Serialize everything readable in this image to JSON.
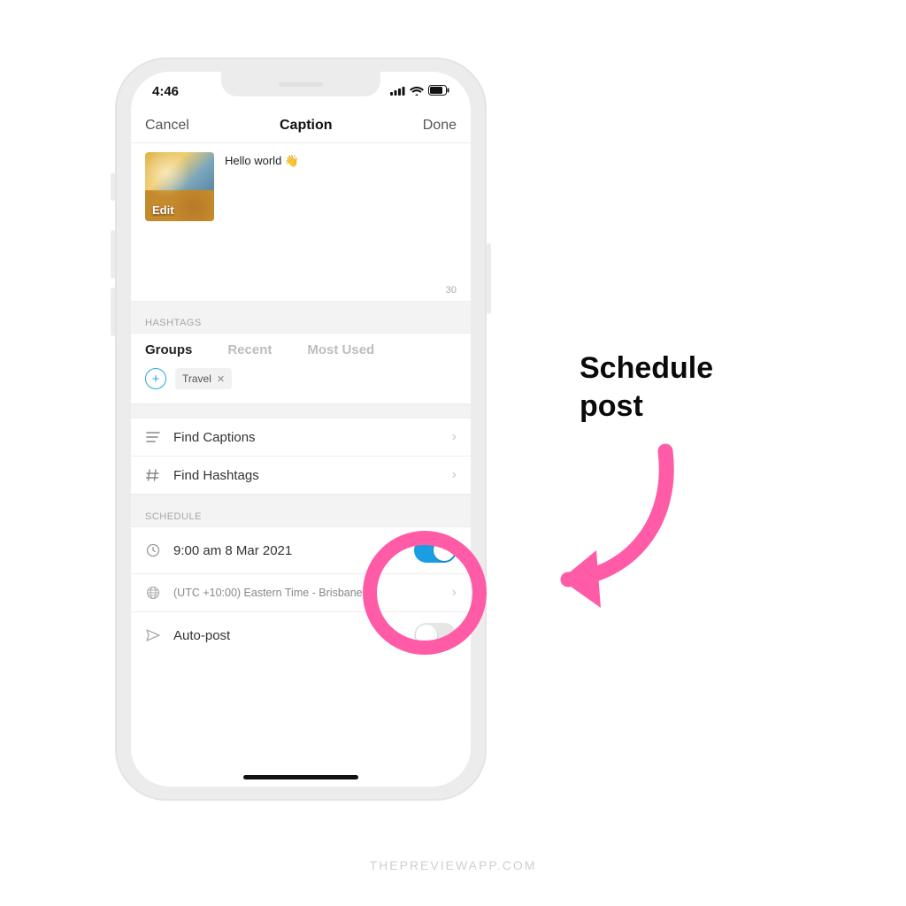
{
  "status": {
    "time": "4:46"
  },
  "nav": {
    "cancel": "Cancel",
    "title": "Caption",
    "done": "Done"
  },
  "caption": {
    "text": "Hello world 👋",
    "count": "30",
    "edit": "Edit"
  },
  "hashtags": {
    "label": "HASHTAGS",
    "tabs": {
      "groups": "Groups",
      "recent": "Recent",
      "mostUsed": "Most Used"
    },
    "chip": "Travel"
  },
  "rows": {
    "findCaptions": "Find Captions",
    "findHashtags": "Find Hashtags"
  },
  "schedule": {
    "label": "SCHEDULE",
    "time": "9:00 am  8 Mar 2021",
    "tz": "(UTC +10:00) Eastern Time - Brisbane",
    "autopost": "Auto-post"
  },
  "annotation": {
    "label": "Schedule\npost"
  },
  "watermark": "THEPREVIEWAPP.COM"
}
